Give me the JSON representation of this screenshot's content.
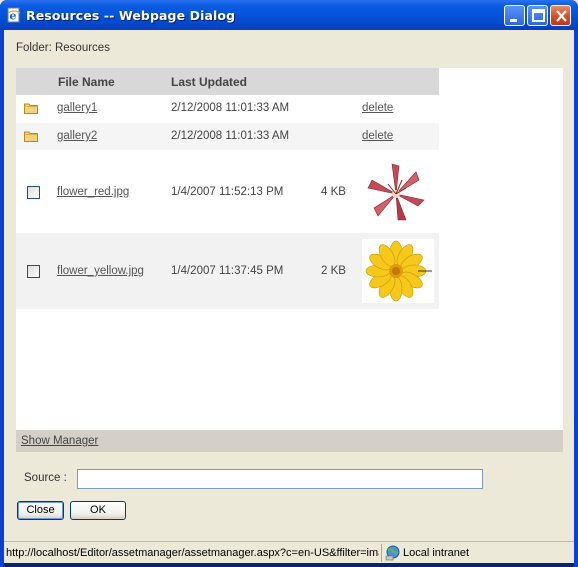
{
  "window": {
    "title": "Resources -- Webpage Dialog"
  },
  "folder": {
    "label": "Folder: Resources"
  },
  "table": {
    "headers": {
      "file_name": "File Name",
      "last_updated": "Last Updated"
    },
    "rows": [
      {
        "type": "folder",
        "name": "gallery1",
        "updated": "2/12/2008 11:01:33 AM",
        "action": "delete"
      },
      {
        "type": "folder",
        "name": "gallery2",
        "updated": "2/12/2008 11:01:33 AM",
        "action": "delete"
      },
      {
        "type": "file",
        "name": "flower_red.jpg",
        "updated": "1/4/2007 11:52:13 PM",
        "size": "4 KB"
      },
      {
        "type": "file",
        "name": "flower_yellow.jpg",
        "updated": "1/4/2007 11:37:45 PM",
        "size": "2 KB"
      }
    ]
  },
  "manager": {
    "show_label": "Show Manager"
  },
  "source": {
    "label": "Source :",
    "value": ""
  },
  "buttons": {
    "close": "Close",
    "ok": "OK"
  },
  "statusbar": {
    "url": "http://localhost/Editor/assetmanager/assetmanager.aspx?c=en-US&ffilter=image",
    "zone": "Local intranet"
  },
  "colors": {
    "titlebar": "#0553DA",
    "dialog_bg": "#ECE9D8",
    "header_bg": "#D8D8D8"
  }
}
